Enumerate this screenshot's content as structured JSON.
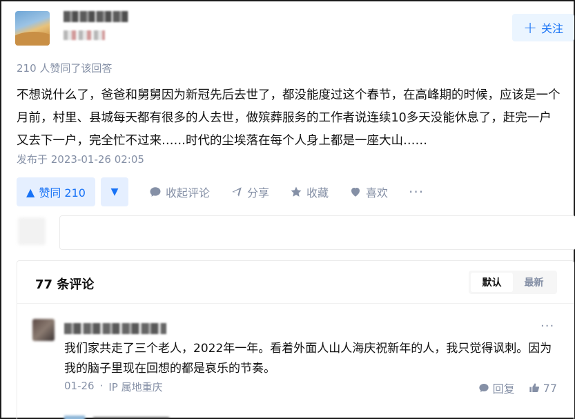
{
  "follow": {
    "label": "关注"
  },
  "answer": {
    "vote_summary": "210 人赞同了该回答",
    "text": "不想说什么了，爸爸和舅舅因为新冠先后去世了，都没能度过这个春节，在高峰期的时候，应该是一个月前，村里、县城每天都有很多的人去世，做殡葬服务的工作者说连续10多天没能休息了，赶完一户又去下一户，完全忙不过来……时代的尘埃落在每个人身上都是一座大山……",
    "published": "发布于 2023-01-26 02:05"
  },
  "actions": {
    "upvote_label": "赞同 210",
    "collapse_comments": "收起评论",
    "share": "分享",
    "favorite": "收藏",
    "like": "喜欢",
    "more": "···"
  },
  "comments": {
    "count_label": "77 条评论",
    "sort_default": "默认",
    "sort_latest": "最新",
    "items": [
      {
        "text": "我们家共走了三个老人，2022年一年。看着外面人山人海庆祝新年的人，我只觉得讽刺。因为我的脑子里现在回想的都是哀乐的节奏。",
        "date": "01-26",
        "separator": "·",
        "location": "IP 属地重庆",
        "reply_label": "回复",
        "likes": "77",
        "more": "···"
      }
    ]
  },
  "colors": {
    "accent": "#1772f6",
    "accent_bg": "#e5efff",
    "muted": "#8590a6"
  }
}
